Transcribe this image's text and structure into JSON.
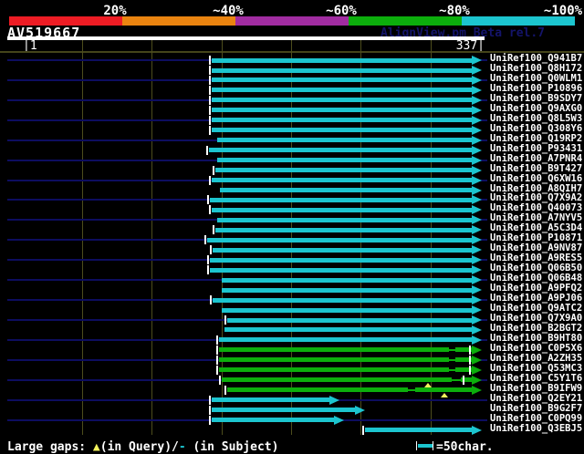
{
  "palette": {
    "red": "#ed1c24",
    "orange": "#ea8410",
    "purple": "#a12ca1",
    "green": "#0cae0c",
    "cyan": "#1cc5cf",
    "navy_line": "#0d0d60",
    "grid_olive": "#4d4d1c",
    "gap_yellow": "#f2f25c",
    "text_white": "#ffffff",
    "watermark_blue": "#14146a"
  },
  "scale_bar": {
    "segments": [
      {
        "label": "20%",
        "color": "#ed1c24"
      },
      {
        "label": "~40%",
        "color": "#ea8410"
      },
      {
        "label": "~60%",
        "color": "#a12ca1"
      },
      {
        "label": "~80%",
        "color": "#0cae0c"
      },
      {
        "label": "~100%",
        "color": "#1cc5cf"
      }
    ]
  },
  "header": {
    "query_name": "AV519667",
    "watermark": "AlignView.pm Beta rel.7"
  },
  "ruler": {
    "start_label": "|1",
    "end_label": "337|",
    "query_length": 337,
    "tick_interval": 50
  },
  "chart_data": {
    "type": "bar",
    "orientation": "horizontal",
    "title": "BLAST-style alignment overview of query AV519667 vs UniRef100 hits",
    "query": "AV519667",
    "query_length": 337,
    "xlim": [
      1,
      337
    ],
    "identity_legend": [
      "20%",
      "~40%",
      "~60%",
      "~80%",
      "~100%"
    ],
    "hits": [
      {
        "label": "UniRef100_Q941B7",
        "from": 143,
        "to": 337,
        "color": "cyan",
        "start_tick": true,
        "subject_gap": null,
        "end_tick": null,
        "query_gaps": []
      },
      {
        "label": "UniRef100_Q8H172",
        "from": 143,
        "to": 337,
        "color": "cyan",
        "start_tick": true,
        "subject_gap": null,
        "end_tick": null,
        "query_gaps": []
      },
      {
        "label": "UniRef100_Q0WLM1",
        "from": 143,
        "to": 337,
        "color": "cyan",
        "start_tick": true,
        "subject_gap": null,
        "end_tick": null,
        "query_gaps": []
      },
      {
        "label": "UniRef100_P10896",
        "from": 143,
        "to": 337,
        "color": "cyan",
        "start_tick": true,
        "subject_gap": null,
        "end_tick": null,
        "query_gaps": []
      },
      {
        "label": "UniRef100_B9SDY7",
        "from": 143,
        "to": 337,
        "color": "cyan",
        "start_tick": true,
        "subject_gap": null,
        "end_tick": null,
        "query_gaps": []
      },
      {
        "label": "UniRef100_Q9AXG0",
        "from": 143,
        "to": 337,
        "color": "cyan",
        "start_tick": true,
        "subject_gap": null,
        "end_tick": null,
        "query_gaps": []
      },
      {
        "label": "UniRef100_Q8L5W3",
        "from": 143,
        "to": 337,
        "color": "cyan",
        "start_tick": true,
        "subject_gap": null,
        "end_tick": null,
        "query_gaps": []
      },
      {
        "label": "UniRef100_Q308Y6",
        "from": 143,
        "to": 337,
        "color": "cyan",
        "start_tick": true,
        "subject_gap": null,
        "end_tick": null,
        "query_gaps": []
      },
      {
        "label": "UniRef100_Q19RP2",
        "from": 147,
        "to": 337,
        "color": "cyan",
        "start_tick": false,
        "subject_gap": null,
        "end_tick": null,
        "query_gaps": []
      },
      {
        "label": "UniRef100_P93431",
        "from": 141,
        "to": 337,
        "color": "cyan",
        "start_tick": true,
        "subject_gap": null,
        "end_tick": null,
        "query_gaps": []
      },
      {
        "label": "UniRef100_A7PNR4",
        "from": 147,
        "to": 337,
        "color": "cyan",
        "start_tick": false,
        "subject_gap": null,
        "end_tick": null,
        "query_gaps": []
      },
      {
        "label": "UniRef100_B9T427",
        "from": 146,
        "to": 337,
        "color": "cyan",
        "start_tick": true,
        "subject_gap": null,
        "end_tick": null,
        "query_gaps": []
      },
      {
        "label": "UniRef100_Q6XW16",
        "from": 143,
        "to": 337,
        "color": "cyan",
        "start_tick": true,
        "subject_gap": null,
        "end_tick": null,
        "query_gaps": []
      },
      {
        "label": "UniRef100_A8QIH7",
        "from": 149,
        "to": 337,
        "color": "cyan",
        "start_tick": false,
        "subject_gap": null,
        "end_tick": null,
        "query_gaps": []
      },
      {
        "label": "UniRef100_Q7X9A2",
        "from": 142,
        "to": 337,
        "color": "cyan",
        "start_tick": true,
        "subject_gap": null,
        "end_tick": null,
        "query_gaps": []
      },
      {
        "label": "UniRef100_Q40073",
        "from": 143,
        "to": 337,
        "color": "cyan",
        "start_tick": true,
        "subject_gap": null,
        "end_tick": null,
        "query_gaps": []
      },
      {
        "label": "UniRef100_A7NYV5",
        "from": 147,
        "to": 337,
        "color": "cyan",
        "start_tick": false,
        "subject_gap": null,
        "end_tick": null,
        "query_gaps": []
      },
      {
        "label": "UniRef100_A5C3D4",
        "from": 146,
        "to": 337,
        "color": "cyan",
        "start_tick": true,
        "subject_gap": null,
        "end_tick": null,
        "query_gaps": []
      },
      {
        "label": "UniRef100_P10871",
        "from": 140,
        "to": 337,
        "color": "cyan",
        "start_tick": true,
        "subject_gap": null,
        "end_tick": null,
        "query_gaps": []
      },
      {
        "label": "UniRef100_A9NV87",
        "from": 144,
        "to": 337,
        "color": "cyan",
        "start_tick": true,
        "subject_gap": null,
        "end_tick": null,
        "query_gaps": []
      },
      {
        "label": "UniRef100_A9RES5",
        "from": 142,
        "to": 337,
        "color": "cyan",
        "start_tick": true,
        "subject_gap": null,
        "end_tick": null,
        "query_gaps": []
      },
      {
        "label": "UniRef100_Q06B50",
        "from": 142,
        "to": 337,
        "color": "cyan",
        "start_tick": true,
        "subject_gap": null,
        "end_tick": null,
        "query_gaps": []
      },
      {
        "label": "UniRef100_Q06B48",
        "from": 150,
        "to": 337,
        "color": "cyan",
        "start_tick": false,
        "subject_gap": null,
        "end_tick": null,
        "query_gaps": []
      },
      {
        "label": "UniRef100_A9PFQ2",
        "from": 150,
        "to": 337,
        "color": "cyan",
        "start_tick": false,
        "subject_gap": null,
        "end_tick": null,
        "query_gaps": []
      },
      {
        "label": "UniRef100_A9PJ06",
        "from": 144,
        "to": 337,
        "color": "cyan",
        "start_tick": true,
        "subject_gap": null,
        "end_tick": null,
        "query_gaps": []
      },
      {
        "label": "UniRef100_Q9ATC2",
        "from": 150,
        "to": 337,
        "color": "cyan",
        "start_tick": false,
        "subject_gap": null,
        "end_tick": null,
        "query_gaps": []
      },
      {
        "label": "UniRef100_Q7X9A0",
        "from": 154,
        "to": 337,
        "color": "cyan",
        "start_tick": true,
        "subject_gap": null,
        "end_tick": null,
        "query_gaps": []
      },
      {
        "label": "UniRef100_B2BGT2",
        "from": 152,
        "to": 337,
        "color": "cyan",
        "start_tick": false,
        "subject_gap": null,
        "end_tick": null,
        "query_gaps": []
      },
      {
        "label": "UniRef100_B9HT80",
        "from": 148,
        "to": 337,
        "color": "cyan",
        "start_tick": true,
        "subject_gap": null,
        "end_tick": null,
        "query_gaps": []
      },
      {
        "label": "UniRef100_C0P5X6",
        "from": 148,
        "to": 337,
        "color": "green",
        "start_tick": true,
        "subject_gap": [
          313,
          318
        ],
        "end_tick": 328,
        "query_gaps": []
      },
      {
        "label": "UniRef100_A2ZH35",
        "from": 148,
        "to": 337,
        "color": "green",
        "start_tick": true,
        "subject_gap": [
          313,
          318
        ],
        "end_tick": 328,
        "query_gaps": []
      },
      {
        "label": "UniRef100_Q53MC3",
        "from": 148,
        "to": 337,
        "color": "green",
        "start_tick": true,
        "subject_gap": [
          313,
          318
        ],
        "end_tick": 328,
        "query_gaps": []
      },
      {
        "label": "UniRef100_C5Y1T6",
        "from": 150,
        "to": 337,
        "color": "green",
        "start_tick": true,
        "subject_gap": [
          315,
          322
        ],
        "end_tick": 323,
        "query_gaps": [
          298
        ]
      },
      {
        "label": "UniRef100_B9IFW9",
        "from": 154,
        "to": 337,
        "color": "green",
        "start_tick": true,
        "subject_gap": [
          284,
          289
        ],
        "end_tick": null,
        "query_gaps": [
          310
        ]
      },
      {
        "label": "UniRef100_Q2EY21",
        "from": 143,
        "to": 235,
        "color": "cyan",
        "start_tick": true,
        "subject_gap": null,
        "end_tick": null,
        "query_gaps": []
      },
      {
        "label": "UniRef100_B9G2F7",
        "from": 143,
        "to": 253,
        "color": "cyan",
        "start_tick": true,
        "subject_gap": null,
        "end_tick": null,
        "query_gaps": []
      },
      {
        "label": "UniRef100_C0PQ99",
        "from": 143,
        "to": 238,
        "color": "cyan",
        "start_tick": true,
        "subject_gap": null,
        "end_tick": null,
        "query_gaps": []
      },
      {
        "label": "UniRef100_Q3EBJ5",
        "from": 253,
        "to": 337,
        "color": "cyan",
        "start_tick": true,
        "subject_gap": null,
        "end_tick": null,
        "query_gaps": []
      }
    ]
  },
  "footer": {
    "gaps_prefix": "Large gaps: ",
    "query_gap_symbol": "▲",
    "query_gap_text": "(in Query)/",
    "subject_gap_symbol": "-",
    "subject_gap_text": " (in Subject)",
    "scale_legend_text": "=50char."
  }
}
